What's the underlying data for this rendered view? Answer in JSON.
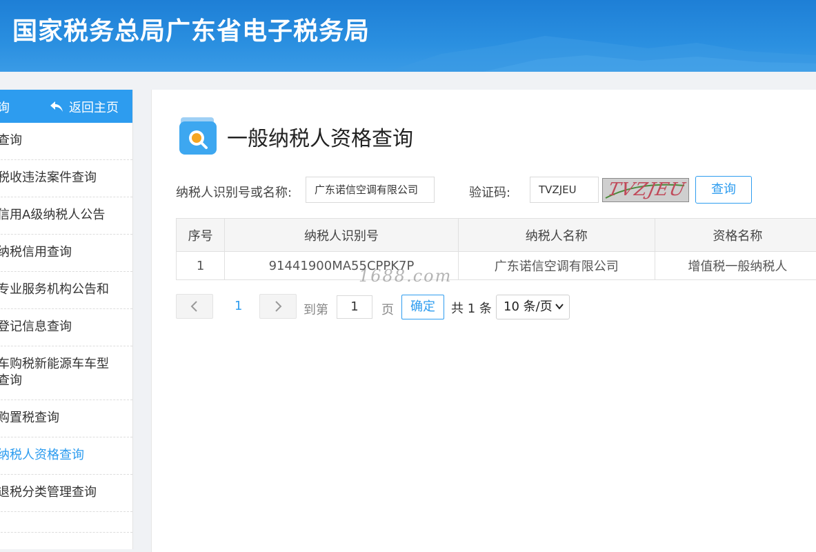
{
  "header": {
    "title": "国家税务总局广东省电子税务局"
  },
  "sidebar": {
    "head_title": "询",
    "back_label": "返回主页",
    "items": [
      {
        "label": "查询",
        "active": false
      },
      {
        "label": "税收违法案件查询",
        "active": false
      },
      {
        "label": "信用A级纳税人公告",
        "active": false
      },
      {
        "label": "纳税信用查询",
        "active": false
      },
      {
        "label": "专业服务机构公告和\n ",
        "active": false
      },
      {
        "label": "登记信息查询",
        "active": false
      },
      {
        "label": "车购税新能源车车型\n查询",
        "active": false
      },
      {
        "label": "购置税查询",
        "active": false
      },
      {
        "label": "纳税人资格查询",
        "active": true
      },
      {
        "label": "退税分类管理查询",
        "active": false
      },
      {
        "label": "",
        "active": false
      }
    ]
  },
  "main": {
    "title": "一般纳税人资格查询",
    "form": {
      "taxpayer_label": "纳税人识别号或名称:",
      "taxpayer_value": "广东诺信空调有限公司",
      "captcha_label": "验证码:",
      "captcha_value": "TVZJEU",
      "captcha_image_text": "TVZJEU",
      "query_button": "查询"
    },
    "table": {
      "headers": [
        "序号",
        "纳税人识别号",
        "纳税人名称",
        "资格名称"
      ],
      "rows": [
        [
          "1",
          "91441900MA55CPPK7P",
          "广东诺信空调有限公司",
          "增值税一般纳税人"
        ]
      ]
    },
    "watermark": "1688.com",
    "pager": {
      "current_page": "1",
      "goto_label": "到第",
      "goto_value": "1",
      "page_suffix": "页",
      "confirm_label": "确定",
      "total_text": "共 1 条",
      "page_size": "10 条/页"
    }
  },
  "colors": {
    "accent": "#2d9cef",
    "banner": "#1e7fd6"
  }
}
